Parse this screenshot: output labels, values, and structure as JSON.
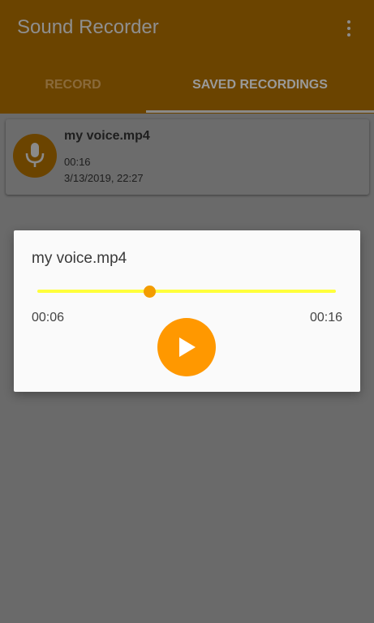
{
  "app": {
    "title": "Sound Recorder",
    "overflow_icon": "more-vert-icon"
  },
  "tabs": [
    {
      "label": "RECORD",
      "selected": false
    },
    {
      "label": "SAVED RECORDINGS",
      "selected": true
    }
  ],
  "recordings": [
    {
      "name": "my voice.mp4",
      "duration": "00:16",
      "date": "3/13/2019, 22:27",
      "icon": "microphone-icon"
    }
  ],
  "player": {
    "title": "my voice.mp4",
    "current_time": "00:06",
    "total_time": "00:16",
    "progress": 0.375,
    "play_icon": "play-icon"
  },
  "colors": {
    "primary": "#6b4400",
    "accent": "#ff9800",
    "track": "#ffff3b",
    "thumb": "#f39c00"
  }
}
